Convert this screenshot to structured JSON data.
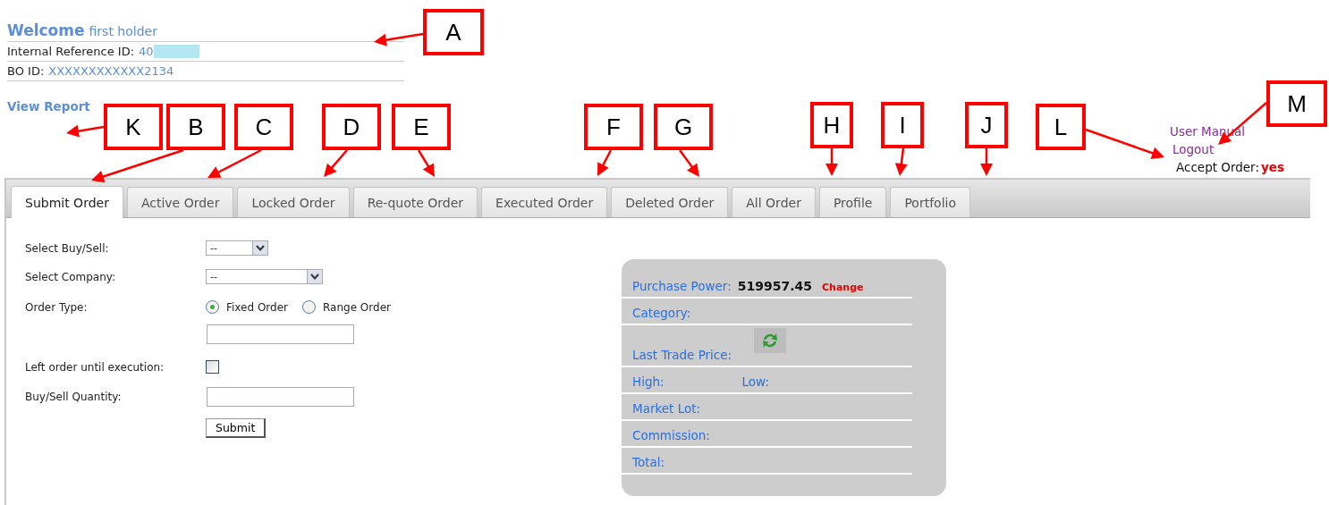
{
  "header": {
    "welcome": "Welcome",
    "holder": "first holder",
    "fields": [
      {
        "label": "Internal Reference ID:",
        "value": "40",
        "redacted": true
      },
      {
        "label": "BO ID:",
        "value": "XXXXXXXXXXXX2134",
        "redacted": false
      }
    ],
    "view_report": "View Report"
  },
  "top_links": {
    "user_manual": "User Manual",
    "logout": "Logout",
    "accept_label": "Accept Order:",
    "accept_value": "yes"
  },
  "tabs": [
    {
      "label": "Submit Order",
      "selected": true
    },
    {
      "label": "Active Order",
      "selected": false
    },
    {
      "label": "Locked Order",
      "selected": false
    },
    {
      "label": "Re-quote Order",
      "selected": false
    },
    {
      "label": "Executed Order",
      "selected": false
    },
    {
      "label": "Deleted Order",
      "selected": false
    },
    {
      "label": "All Order",
      "selected": false
    },
    {
      "label": "Profile",
      "selected": false
    },
    {
      "label": "Portfolio",
      "selected": false
    }
  ],
  "form": {
    "rows": [
      {
        "kind": "select",
        "label": "Select Buy/Sell:",
        "value": "--",
        "wide": false
      },
      {
        "kind": "select",
        "label": "Select Company:",
        "value": "--",
        "wide": true
      },
      {
        "kind": "radio",
        "label": "Order Type:",
        "options": [
          {
            "label": "Fixed Order",
            "selected": true
          },
          {
            "label": "Range Order",
            "selected": false
          }
        ]
      },
      {
        "kind": "input"
      },
      {
        "kind": "checkbox",
        "label": "Left order until execution:",
        "checked": false
      },
      {
        "kind": "input",
        "label": "Buy/Sell Quantity:"
      }
    ],
    "submit": "Submit"
  },
  "info_panel": {
    "rows": [
      {
        "kind": "value",
        "label": "Purchase Power:",
        "value": "519957.45",
        "action": "Change"
      },
      {
        "kind": "plain",
        "label": "Category:"
      },
      {
        "kind": "refresh",
        "label": "Last Trade Price:"
      },
      {
        "kind": "pair",
        "label": "High:",
        "label_2": "Low:"
      },
      {
        "kind": "plain",
        "label": "Market Lot:"
      },
      {
        "kind": "plain",
        "label": "Commission:"
      },
      {
        "kind": "plain",
        "label": "Total:"
      }
    ]
  },
  "annotations": [
    {
      "letter": "A"
    },
    {
      "letter": "K"
    },
    {
      "letter": "B"
    },
    {
      "letter": "C"
    },
    {
      "letter": "D"
    },
    {
      "letter": "E"
    },
    {
      "letter": "F"
    },
    {
      "letter": "G"
    },
    {
      "letter": "H"
    },
    {
      "letter": "I"
    },
    {
      "letter": "J"
    },
    {
      "letter": "L"
    },
    {
      "letter": "M"
    }
  ]
}
